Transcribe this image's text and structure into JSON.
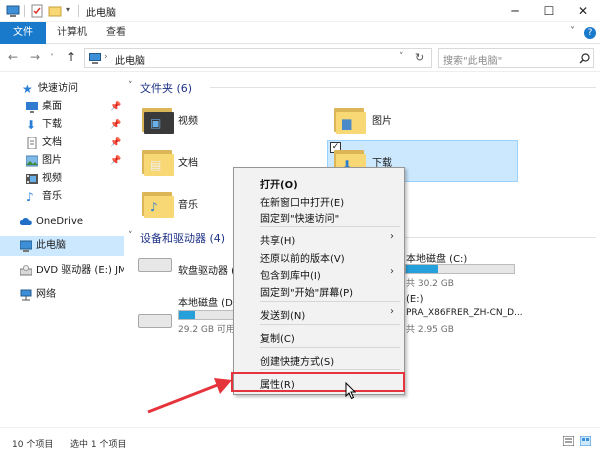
{
  "window": {
    "title": "此电脑",
    "controls": [
      "minimize",
      "maximize",
      "close"
    ]
  },
  "ribbon": {
    "tabs": [
      "文件",
      "计算机",
      "查看"
    ]
  },
  "address_bar": {
    "path": "此电脑",
    "search_placeholder": "搜索\"此电脑\""
  },
  "nav_pane": {
    "items": [
      {
        "label": "快速访问",
        "icon": "star-icon"
      },
      {
        "label": "桌面",
        "icon": "desktop-icon",
        "pinned": true
      },
      {
        "label": "下载",
        "icon": "download-icon",
        "pinned": true
      },
      {
        "label": "文档",
        "icon": "document-icon",
        "pinned": true
      },
      {
        "label": "图片",
        "icon": "picture-icon",
        "pinned": true
      },
      {
        "label": "视频",
        "icon": "video-icon"
      },
      {
        "label": "音乐",
        "icon": "music-icon"
      },
      {
        "label": "OneDrive",
        "icon": "cloud-icon"
      },
      {
        "label": "此电脑",
        "icon": "computer-icon",
        "selected": true
      },
      {
        "label": "DVD 驱动器 (E:) JM",
        "icon": "dvd-icon"
      },
      {
        "label": "网络",
        "icon": "network-icon"
      }
    ]
  },
  "content": {
    "folders_header": "文件夹 (6)",
    "folders": [
      {
        "label": "视频"
      },
      {
        "label": "图片"
      },
      {
        "label": "文档"
      },
      {
        "label": "下载",
        "selected": true
      },
      {
        "label": "音乐"
      }
    ],
    "devices_header": "设备和驱动器 (4)",
    "drives": [
      {
        "label": "软盘驱动器 (A:)"
      },
      {
        "label": "本地磁盘 (D:)",
        "info": "29.2 GB 可用",
        "used_fraction": 0.3
      },
      {
        "label": "本地磁盘 (C:)",
        "info": "共 30.2 GB",
        "used_fraction": 0.3
      },
      {
        "label": "(E:)",
        "sublabel": "PRA_X86FRER_ZH-CN_D...",
        "info": "共 2.95 GB"
      }
    ]
  },
  "context_menu": {
    "items": [
      {
        "label": "打开(O)",
        "bold": true
      },
      {
        "label": "在新窗口中打开(E)"
      },
      {
        "label": "固定到\"快速访问\""
      },
      {
        "label": "共享(H)",
        "submenu": true
      },
      {
        "label": "还原以前的版本(V)"
      },
      {
        "label": "包含到库中(I)",
        "submenu": true
      },
      {
        "label": "固定到\"开始\"屏幕(P)"
      },
      {
        "label": "发送到(N)",
        "submenu": true
      },
      {
        "label": "复制(C)"
      },
      {
        "label": "创建快捷方式(S)"
      },
      {
        "label": "属性(R)",
        "highlighted": true
      }
    ]
  },
  "status": {
    "count": "10 个项目",
    "selected": "选中 1 个项目"
  },
  "colors": {
    "accent": "#1979ca",
    "selection": "#cce8ff",
    "annotation": "#e6343c"
  }
}
